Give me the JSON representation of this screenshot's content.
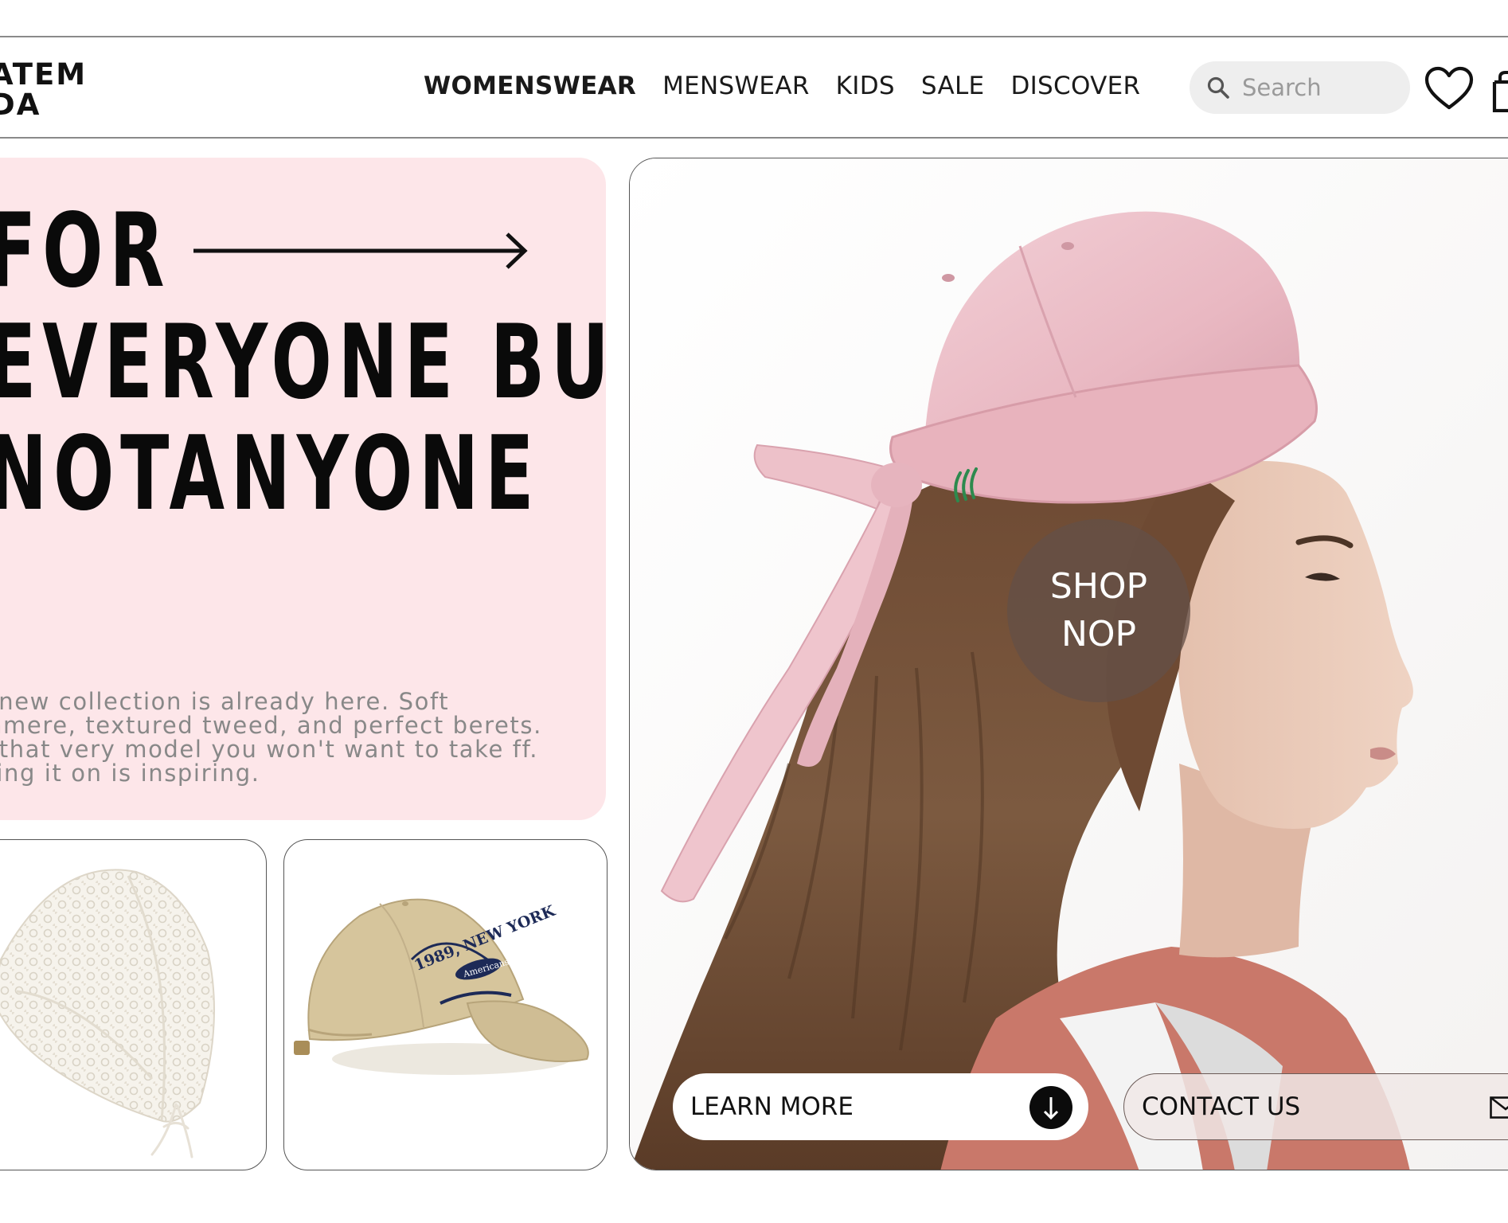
{
  "brand": {
    "logo_line1": "ATEM",
    "logo_line2": "DA"
  },
  "nav": {
    "items": [
      {
        "label": "WOMENSWEAR",
        "active": true
      },
      {
        "label": "MENSWEAR",
        "active": false
      },
      {
        "label": "KIDS",
        "active": false
      },
      {
        "label": "SALE",
        "active": false
      },
      {
        "label": "DISCOVER",
        "active": false
      }
    ]
  },
  "search": {
    "placeholder": "Search"
  },
  "icons": {
    "search": "search-icon",
    "wishlist": "heart-icon",
    "cart": "shopping-bag-icon",
    "arrow": "arrow-right-icon",
    "learn_more": "arrow-down-icon",
    "contact": "mail-icon"
  },
  "hero": {
    "headline_line1": "FOR",
    "headline_line2": "EVERYONE BUT",
    "headline_line3": "NOTANYONE",
    "description": "he new collection is already here. Soft ashmere, textured tweed, and perfect berets. nd that very model you won't want to take ff. Trying it on is inspiring."
  },
  "feature": {
    "shop_line1": "SHOP",
    "shop_line2": "NOP",
    "learn_more": "LEARN MORE",
    "contact_us": "CONTACT US"
  },
  "products": [
    {
      "name": "crochet-headscarf",
      "image": "white crochet lace bandana"
    },
    {
      "name": "baseball-cap",
      "image": "beige cap embroidered 1989 NEW YORK Americans"
    }
  ],
  "cap_embroidery": {
    "line1": "1989, NEW YORK",
    "badge": "Americans"
  },
  "colors": {
    "hero_bg": "#fde6e9",
    "search_bg": "#eeeeee",
    "shop_circle": "#64504680",
    "text_muted": "#888888"
  }
}
